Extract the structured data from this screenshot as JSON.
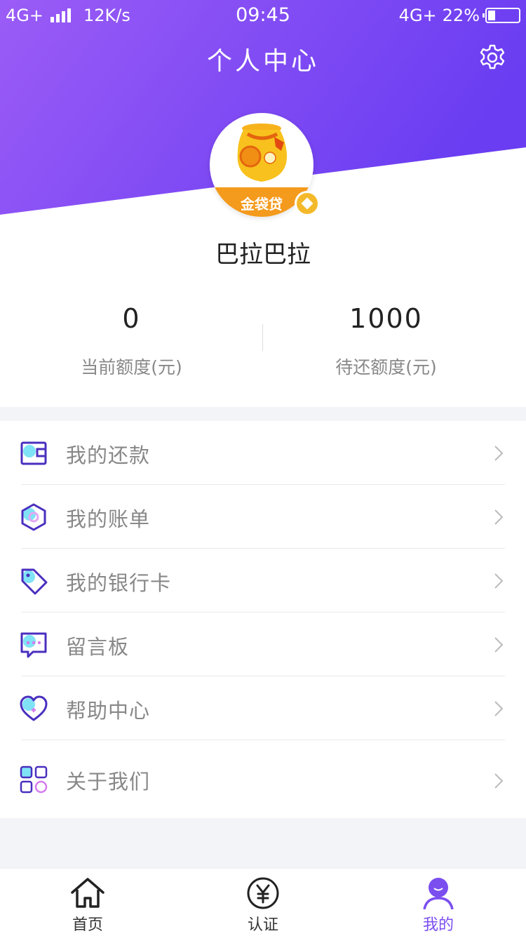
{
  "status_bar": {
    "network_left": "4G+",
    "speed": "12K/s",
    "time": "09:45",
    "network_right": "4G+",
    "battery": "22%"
  },
  "header": {
    "title": "个人中心",
    "settings_icon": "gear-icon"
  },
  "profile": {
    "avatar_logo_text": "金袋贷",
    "username": "巴拉巴拉"
  },
  "stats": [
    {
      "value": "0",
      "label": "当前额度(元)"
    },
    {
      "value": "1000",
      "label": "待还额度(元)"
    }
  ],
  "menu": [
    {
      "label": "我的还款",
      "icon": "wallet-icon"
    },
    {
      "label": "我的账单",
      "icon": "hexagon-bill-icon"
    },
    {
      "label": "我的银行卡",
      "icon": "tag-icon"
    },
    {
      "label": "留言板",
      "icon": "message-board-icon"
    },
    {
      "label": "帮助中心",
      "icon": "heart-help-icon"
    },
    {
      "label": "关于我们",
      "icon": "grid-apps-icon"
    }
  ],
  "tabbar": [
    {
      "label": "首页",
      "icon": "home-icon",
      "active": false
    },
    {
      "label": "认证",
      "icon": "yen-circle-icon",
      "active": false
    },
    {
      "label": "我的",
      "icon": "user-icon",
      "active": true
    }
  ],
  "colors": {
    "brand_gradient_start": "#9b5cf6",
    "brand_gradient_end": "#6a3df2",
    "accent": "#7b4ef0",
    "icon_stroke": "#4a2fbf",
    "icon_fill_cyan": "#7fe3f5",
    "icon_fill_pink": "#e3b8f7"
  }
}
